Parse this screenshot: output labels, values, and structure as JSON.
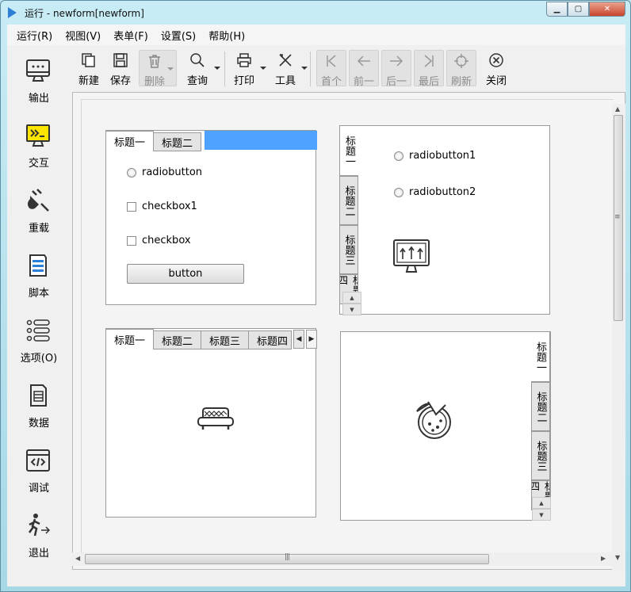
{
  "window": {
    "title": "运行 - newform[newform]"
  },
  "menu": [
    "运行(R)",
    "视图(V)",
    "表单(F)",
    "设置(S)",
    "帮助(H)"
  ],
  "sidebar": [
    {
      "label": "输出",
      "icon": "monitor-icon"
    },
    {
      "label": "交互",
      "icon": "terminal-icon"
    },
    {
      "label": "重载",
      "icon": "plug-icon"
    },
    {
      "label": "脚本",
      "icon": "script-icon"
    },
    {
      "label": "选项(O)",
      "icon": "list-icon"
    },
    {
      "label": "数据",
      "icon": "data-icon"
    },
    {
      "label": "调试",
      "icon": "code-window-icon"
    },
    {
      "label": "退出",
      "icon": "exit-icon"
    }
  ],
  "toolbar": {
    "new": "新建",
    "save": "保存",
    "delete": "删除",
    "query": "查询",
    "print": "打印",
    "tools": "工具",
    "first": "首个",
    "prev": "前一",
    "next": "后一",
    "last": "最后",
    "refresh": "刷新",
    "close": "关闭"
  },
  "panel1": {
    "tabs": [
      "标题一",
      "标题二"
    ],
    "radio": "radiobutton",
    "check1": "checkbox1",
    "check2": "checkbox",
    "button": "button"
  },
  "panel2": {
    "tabs": [
      "标题一",
      "标题二",
      "标题三",
      "标题四"
    ],
    "radio1": "radiobutton1",
    "radio2": "radiobutton2"
  },
  "panel3": {
    "tabs": [
      "标题一",
      "标题二",
      "标题三",
      "标题四"
    ]
  },
  "panel4": {
    "tabs": [
      "标题一",
      "标题二",
      "标题三",
      "标题四"
    ]
  },
  "colors": {
    "accent": "#4da3ff",
    "tab_bg": "#e4e4e4"
  }
}
